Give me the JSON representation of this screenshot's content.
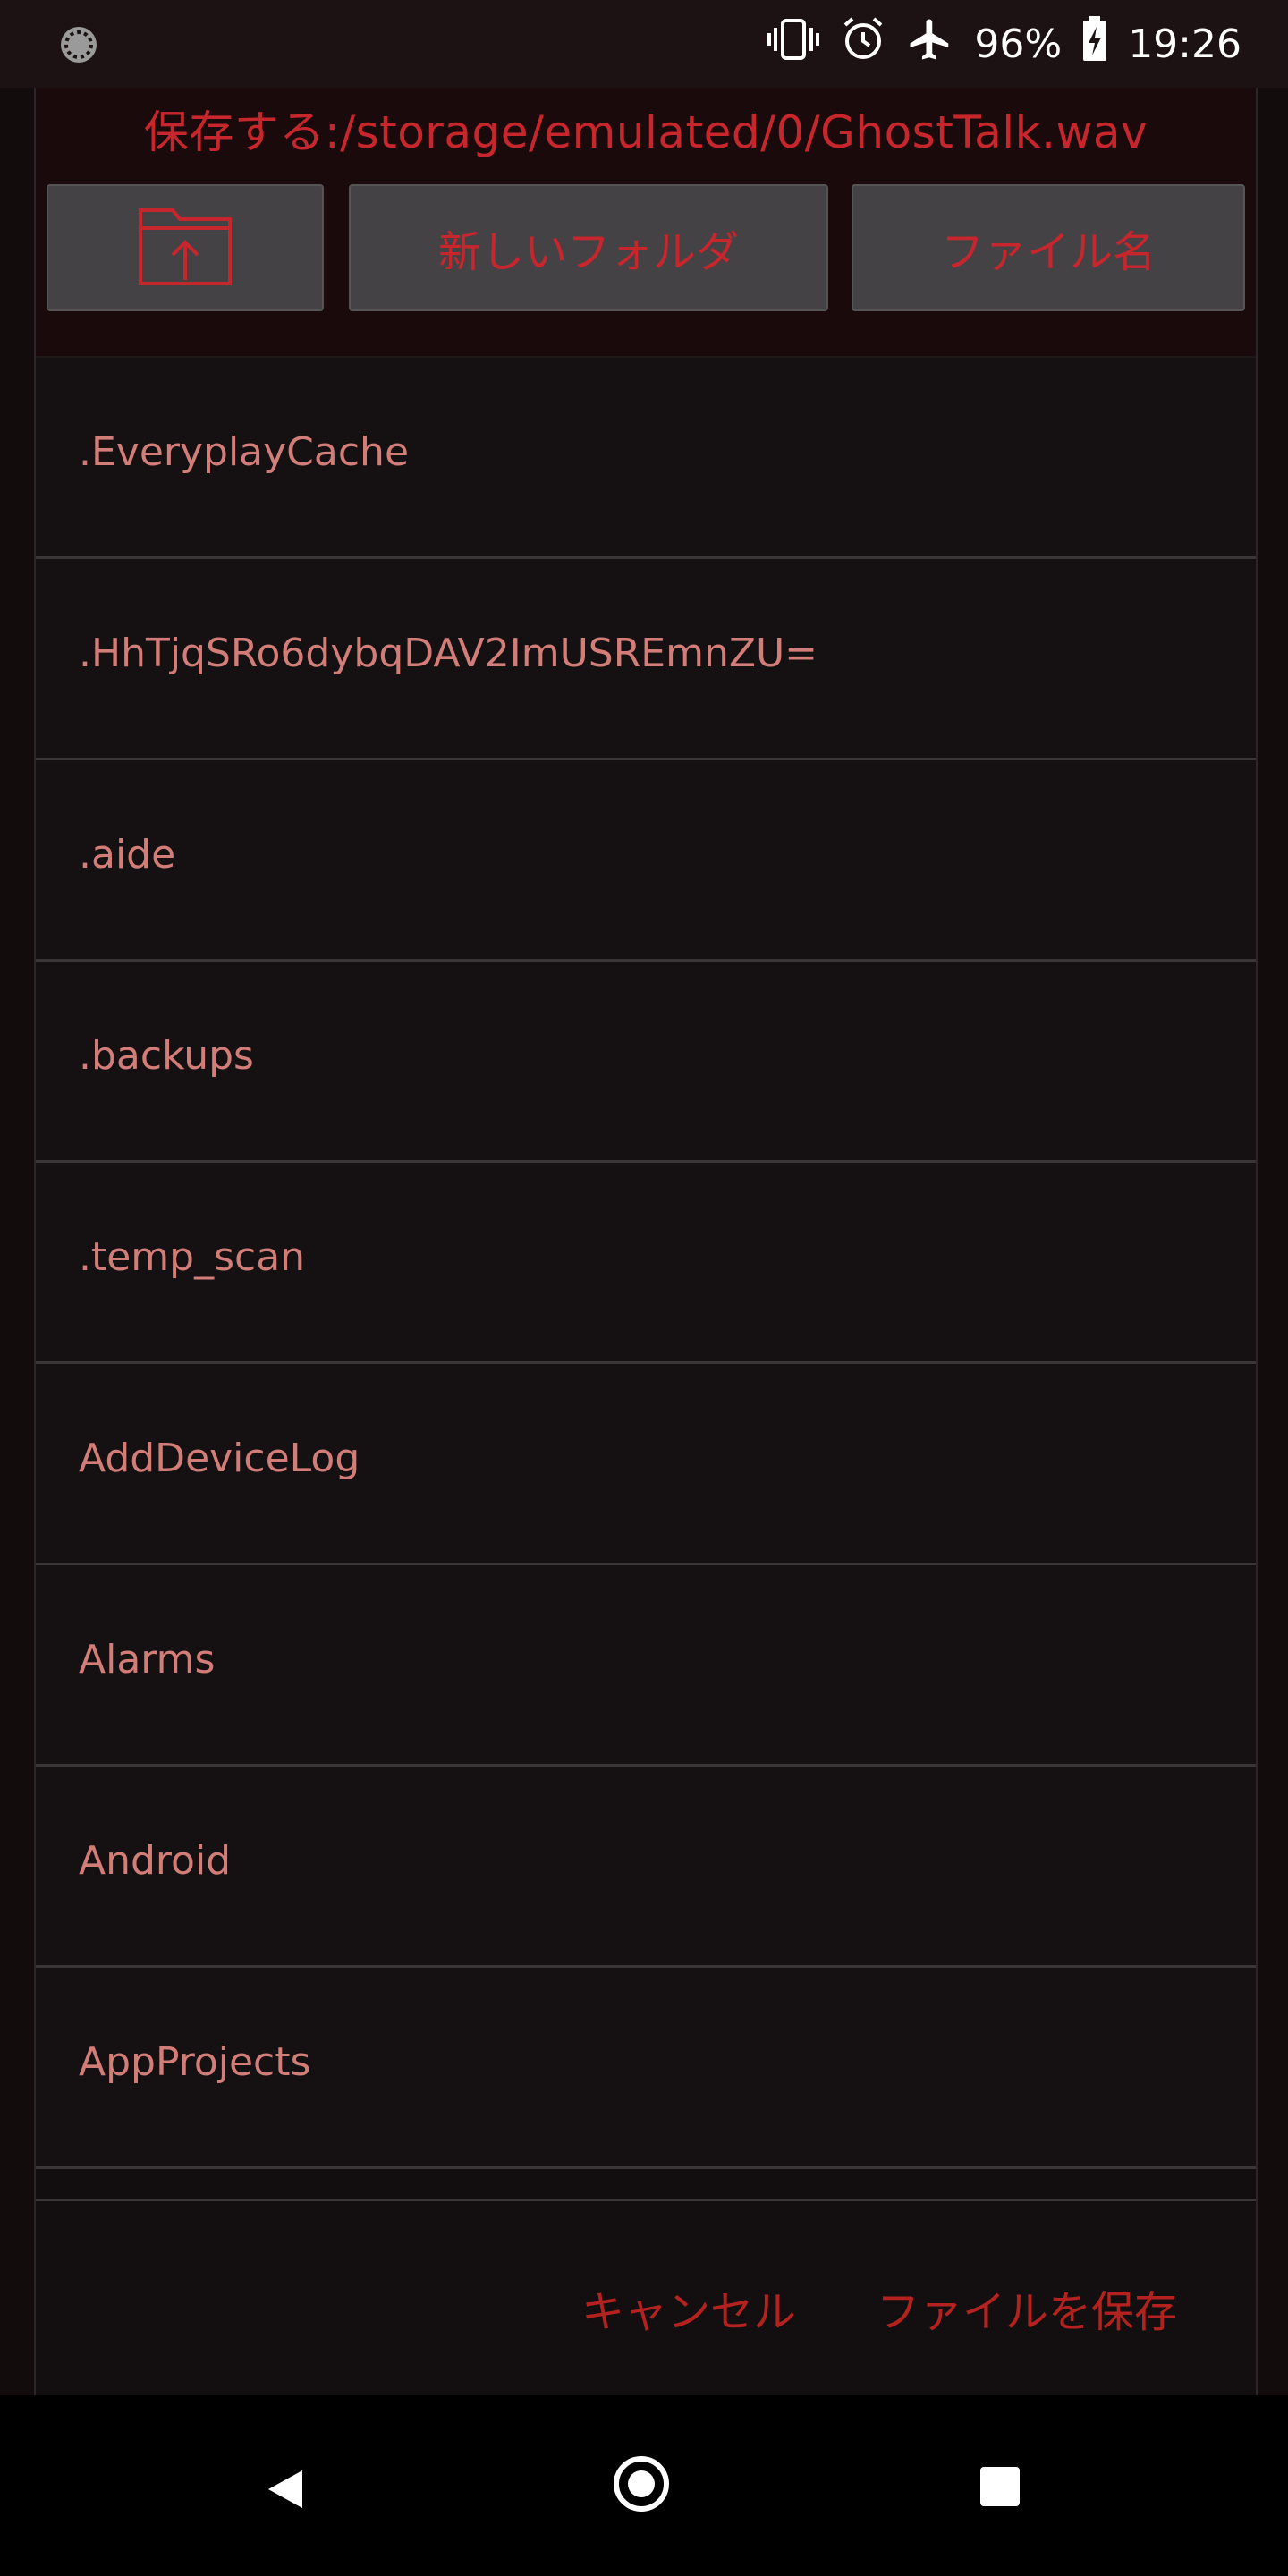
{
  "status_bar": {
    "battery": "96%",
    "time": "19:26",
    "icons": [
      "loading-icon",
      "vibrate-icon",
      "alarm-icon",
      "airplane-icon",
      "battery-charging-icon"
    ]
  },
  "dialog": {
    "title": "保存する:/storage/emulated/0/GhostTalk.wav",
    "buttons": {
      "up_folder_icon": "folder-up-icon",
      "new_folder": "新しいフォルダ",
      "file_name": "ファイル名"
    },
    "items": [
      {
        "label": ".EveryplayCache"
      },
      {
        "label": ".HhTjqSRo6dybqDAV2ImUSREmnZU="
      },
      {
        "label": ".aide"
      },
      {
        "label": ".backups"
      },
      {
        "label": ".temp_scan"
      },
      {
        "label": "AddDeviceLog"
      },
      {
        "label": "Alarms"
      },
      {
        "label": "Android"
      },
      {
        "label": "AppProjects"
      }
    ],
    "footer": {
      "cancel": "キャンセル",
      "save": "ファイルを保存"
    }
  },
  "colors": {
    "accent": "#c8262d",
    "item_text": "#d27d78",
    "background": "#120d0e"
  },
  "nav": {
    "icons": [
      "back-icon",
      "home-icon",
      "recents-icon"
    ]
  }
}
